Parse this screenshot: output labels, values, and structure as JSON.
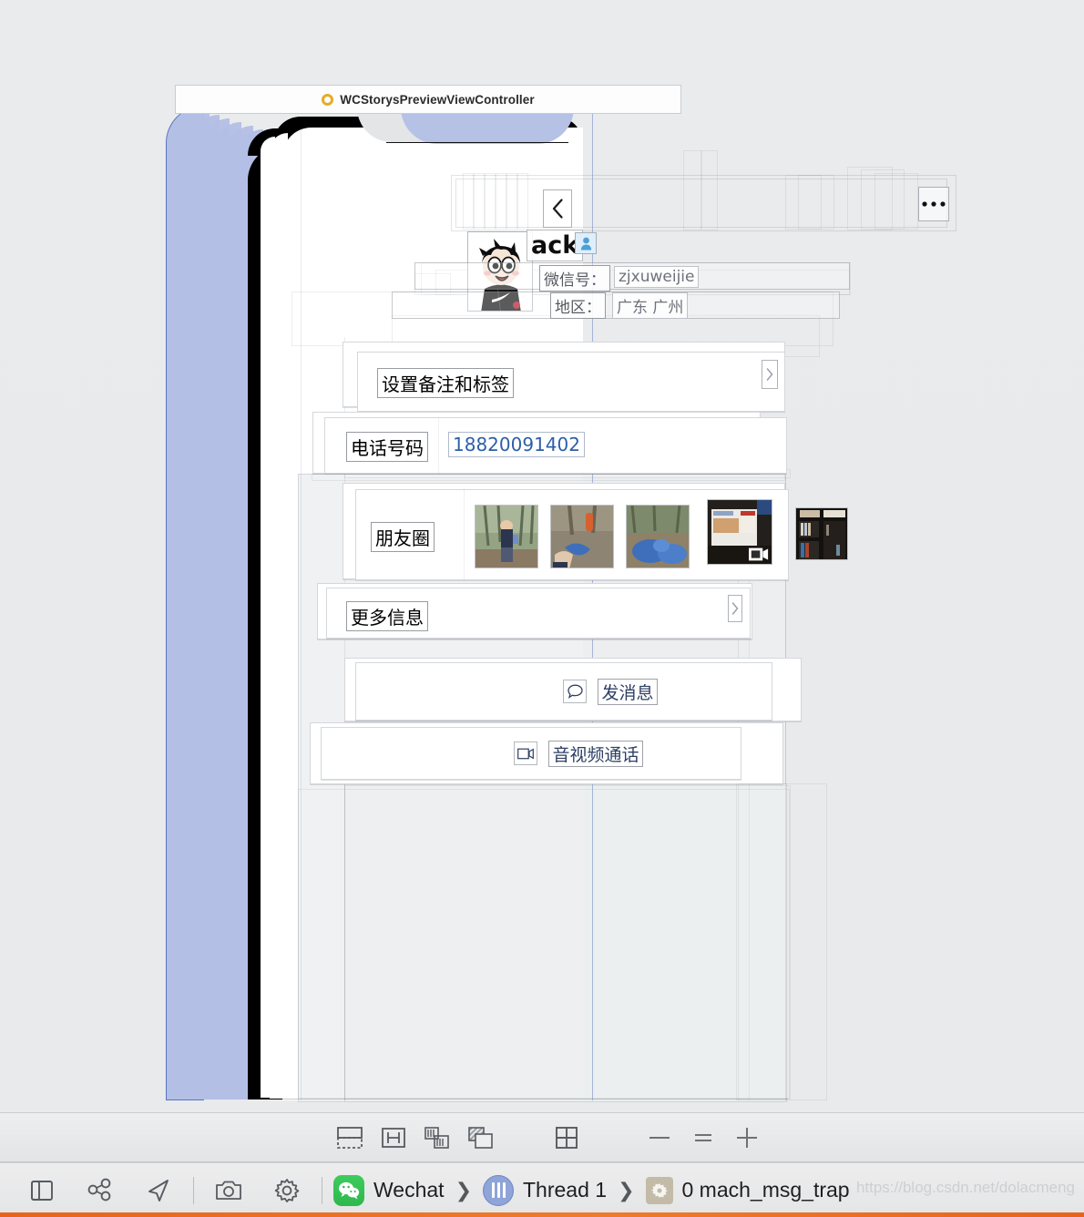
{
  "window": {
    "title": "WCStorysPreviewViewController",
    "title_dot_color": "#e8ab26"
  },
  "nav": {
    "back_icon": "chevron-left-icon",
    "more_icon": "ellipsis-icon",
    "more_label": "•••"
  },
  "contact": {
    "name": "ack",
    "gender_icon": "male-person-icon",
    "wechat_id_label": "微信号：",
    "wechat_id_value": "zjxuweijie",
    "region_label": "地区：",
    "region_value": "广东 广州",
    "avatar_name": "cartoon-avatar"
  },
  "rows": [
    {
      "label": "设置备注和标签",
      "value": "",
      "chevron": true
    },
    {
      "label": "电话号码",
      "value": "18820091402",
      "chevron": false
    },
    {
      "label": "朋友圈",
      "value": "",
      "chevron": false
    },
    {
      "label": "更多信息",
      "value": "",
      "chevron": true
    }
  ],
  "moments": {
    "label": "朋友圈",
    "thumbs": [
      {
        "alt": "person-standing-in-forest",
        "video": false
      },
      {
        "alt": "hands-with-blue-bag-outdoors",
        "video": false
      },
      {
        "alt": "blue-trash-bags-on-ground",
        "video": false
      },
      {
        "alt": "desk-with-monitor-and-calendar",
        "video": true
      },
      {
        "alt": "dark-bookshelf-with-books",
        "video": false
      }
    ]
  },
  "actions": [
    {
      "label": "发消息",
      "icon": "chat-bubble-icon"
    },
    {
      "label": "音视频通话",
      "icon": "video-camera-icon"
    }
  ],
  "canvas_toolbar": {
    "buttons": [
      {
        "name": "show-clipped-content-icon",
        "label": ""
      },
      {
        "name": "show-constraints-icon",
        "label": ""
      },
      {
        "name": "adjust-view-spacing-icon",
        "label": ""
      },
      {
        "name": "show-view-contents-icon",
        "label": ""
      },
      {
        "name": "normal-view-mode-icon",
        "label": ""
      }
    ],
    "zoom_out_label": "—",
    "zoom_reset_label": "=",
    "zoom_in_label": "+"
  },
  "debug_bar": {
    "icons": [
      {
        "name": "toggle-navigator-icon"
      },
      {
        "name": "view-hierarchy-icon"
      },
      {
        "name": "location-arrow-icon"
      },
      {
        "name": "camera-icon"
      },
      {
        "name": "gear-icon"
      }
    ],
    "process_name": "Wechat",
    "thread_name": "Thread 1",
    "frame_name": "0 mach_msg_trap",
    "separator": "❯",
    "process_icon": "wechat-app-icon",
    "thread_icon": "thread-icon",
    "frame_icon": "stack-frame-icon"
  },
  "watermark": {
    "text": "https://blog.csdn.net/dolacmeng"
  },
  "colors": {
    "accent_blue": "#b3bfe5",
    "selection_border": "#5b74c0",
    "orange_bar": "#e8641c",
    "link_blue": "#2d5fa8"
  }
}
